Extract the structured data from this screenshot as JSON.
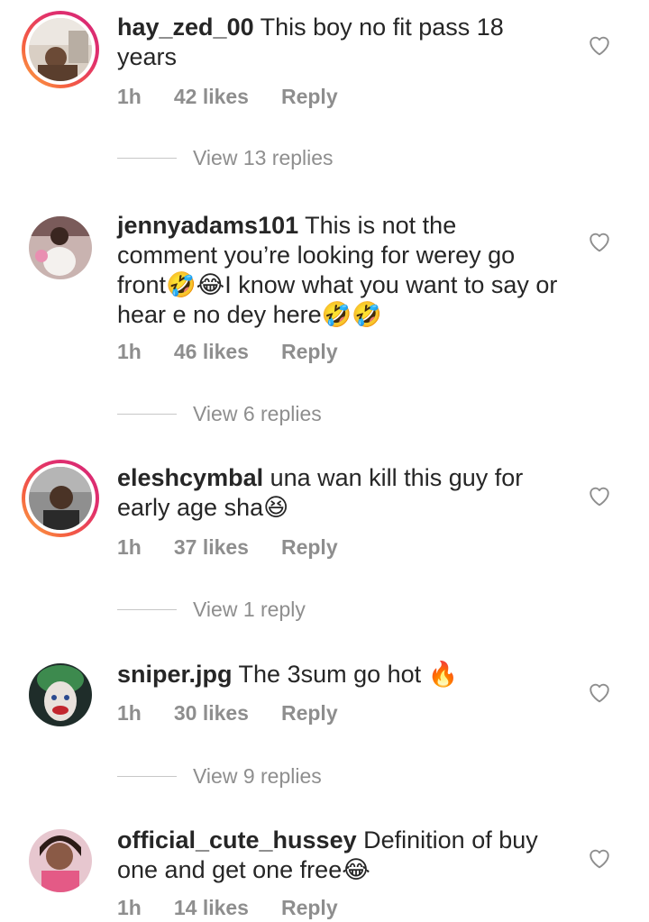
{
  "comments": [
    {
      "username": "hay_zed_00",
      "text": " This boy no fit pass 18 years",
      "time": "1h",
      "likes": "42 likes",
      "reply": "Reply",
      "view_replies": "View 13 replies",
      "avatar_story_ring": true
    },
    {
      "username": "jennyadams101",
      "text": " This is not the comment you’re looking for werey go front🤣😂I know what you want to say or hear e no dey here🤣🤣",
      "time": "1h",
      "likes": "46 likes",
      "reply": "Reply",
      "view_replies": "View 6 replies",
      "avatar_story_ring": false
    },
    {
      "username": "eleshcymbal",
      "text": " una wan kill this guy for early age sha😆",
      "time": "1h",
      "likes": "37 likes",
      "reply": "Reply",
      "view_replies": "View 1 reply",
      "avatar_story_ring": true
    },
    {
      "username": "sniper.jpg",
      "text": " The 3sum go hot 🔥",
      "time": "1h",
      "likes": "30 likes",
      "reply": "Reply",
      "view_replies": "View 9 replies",
      "avatar_story_ring": false
    },
    {
      "username": "official_cute_hussey",
      "text": " Definition of buy one and get one free😂",
      "time": "1h",
      "likes": "14 likes",
      "reply": "Reply",
      "avatar_story_ring": false
    }
  ],
  "colors": {
    "text": "#262626",
    "secondary": "#8e8e8e",
    "story_ring_start": "#fcaf45",
    "story_ring_end": "#d62976"
  },
  "icons": {
    "like": "heart-outline-icon"
  }
}
